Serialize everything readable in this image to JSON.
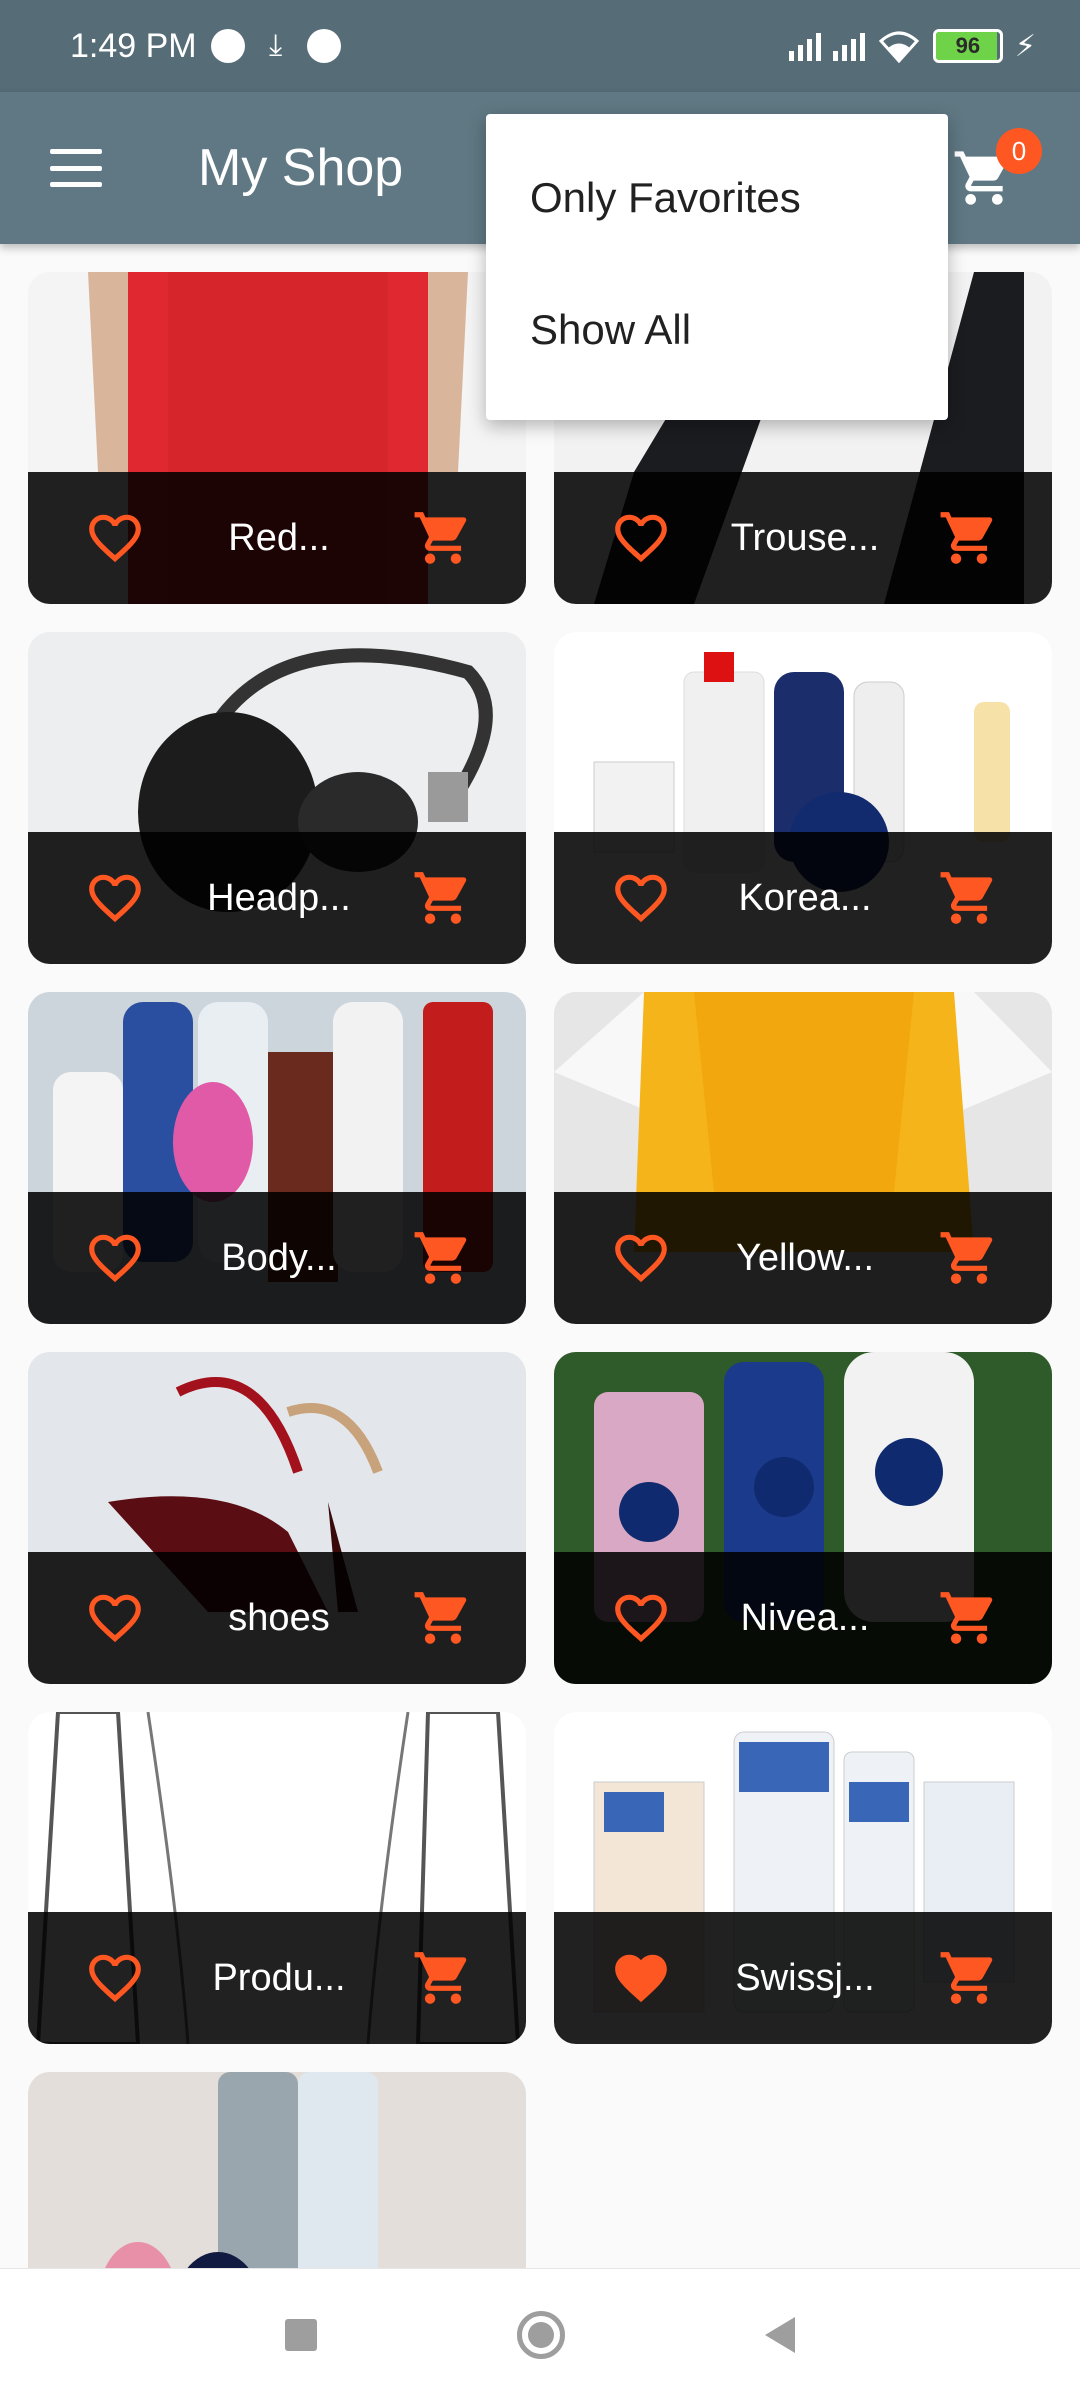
{
  "status_bar": {
    "time": "1:49 PM",
    "battery": "96"
  },
  "app_bar": {
    "title": "My Shop",
    "cart_count": "0"
  },
  "popup_menu": {
    "items": [
      "Only Favorites",
      "Show All"
    ]
  },
  "products": [
    {
      "title": "Red...",
      "favorite": false,
      "image": "red-shirt"
    },
    {
      "title": "Trouse...",
      "favorite": false,
      "image": "trousers"
    },
    {
      "title": "Headp...",
      "favorite": false,
      "image": "headphones"
    },
    {
      "title": "Korea...",
      "favorite": false,
      "image": "lotions"
    },
    {
      "title": "Body...",
      "favorite": false,
      "image": "deodorants"
    },
    {
      "title": "Yellow...",
      "favorite": false,
      "image": "yellow-scarf"
    },
    {
      "title": "shoes",
      "favorite": false,
      "image": "shoes"
    },
    {
      "title": "Nivea...",
      "favorite": false,
      "image": "nivea-products"
    },
    {
      "title": "Produ...",
      "favorite": false,
      "image": "jacket-sketch"
    },
    {
      "title": "Swissj...",
      "favorite": true,
      "image": "ky-gel"
    },
    {
      "title": "",
      "favorite": false,
      "image": "sprays"
    }
  ],
  "colors": {
    "status_bar": "#566c76",
    "app_bar": "#5f7883",
    "accent": "#ff5722",
    "card_footer": "#000000"
  }
}
